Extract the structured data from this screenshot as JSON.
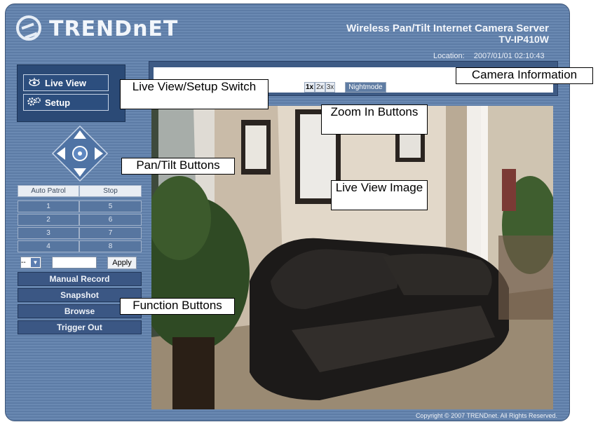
{
  "header": {
    "logo_text": "TRENDnET",
    "product_title": "Wireless Pan/Tilt Internet Camera Server",
    "product_model": "TV-IP410W",
    "location_label": "Location:",
    "datetime": "2007/01/01 02:10:43"
  },
  "mode_switch": {
    "live_view_label": "Live View",
    "setup_label": "Setup"
  },
  "zoom": {
    "buttons": [
      "1x",
      "2x",
      "3x"
    ],
    "active": "1x",
    "nightmode_label": "Nightmode"
  },
  "patrol_table": {
    "headers": [
      "Auto Patrol",
      "Stop"
    ],
    "rows": [
      [
        "1",
        "5"
      ],
      [
        "2",
        "6"
      ],
      [
        "3",
        "7"
      ],
      [
        "4",
        "8"
      ]
    ]
  },
  "preset": {
    "select_value": "--",
    "apply_label": "Apply"
  },
  "functions": [
    "Manual Record",
    "Snapshot",
    "Browse",
    "Trigger Out"
  ],
  "annotations": {
    "camera_information": "Camera Information",
    "live_view_setup_switch": "Live View/Setup Switch",
    "zoom_in_buttons": "Zoom In Buttons",
    "pan_tilt_buttons": "Pan/Tilt Buttons",
    "live_view_image": "Live View Image",
    "function_buttons": "Function Buttons"
  },
  "footer": {
    "copyright": "Copyright © 2007 TRENDnet. All Rights Reserved."
  },
  "icons": {
    "logo": "trendnet-logo-icon",
    "live_view": "eye-icon",
    "setup": "gears-icon",
    "ptz": "dpad-icon"
  },
  "colors": {
    "frame": "#5d7ca6",
    "panel_dark": "#2b4a76",
    "button": "#3b5784"
  }
}
